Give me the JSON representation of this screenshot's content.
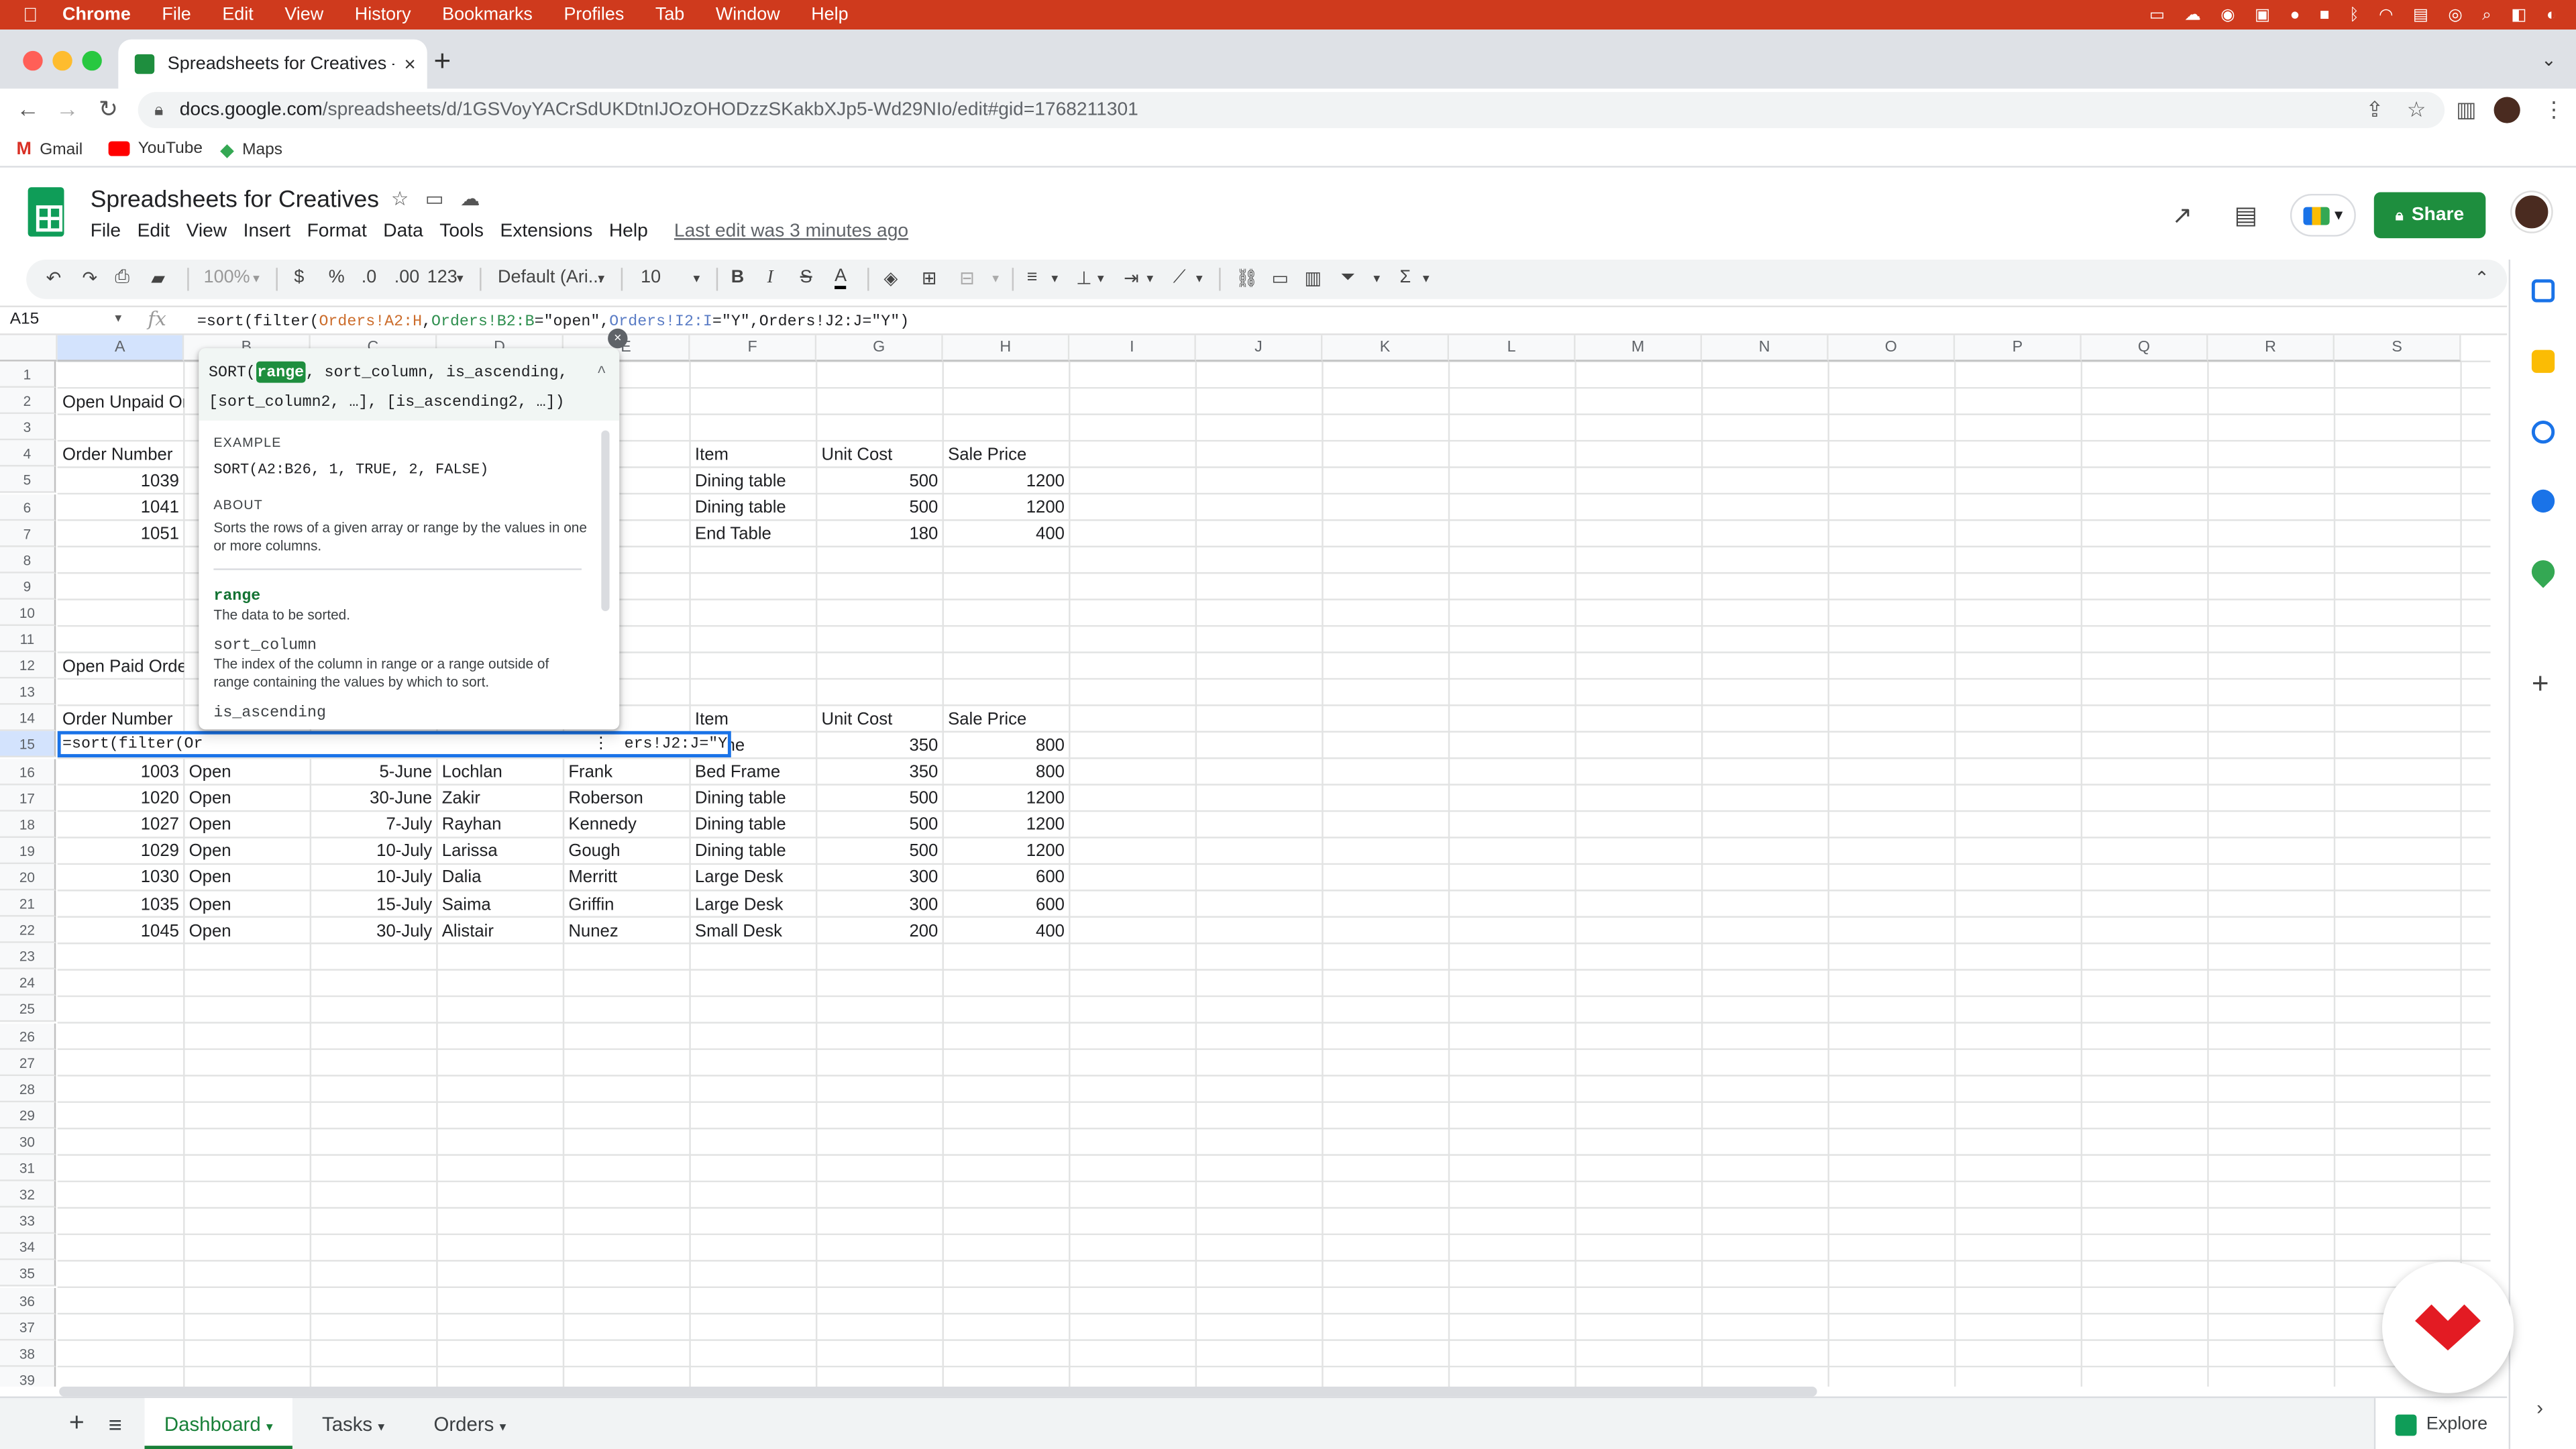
{
  "mac_menu": {
    "apple": "",
    "app": "Chrome",
    "items": [
      "File",
      "Edit",
      "View",
      "History",
      "Bookmarks",
      "Profiles",
      "Tab",
      "Window",
      "Help"
    ]
  },
  "browser": {
    "tab_title": "Spreadsheets for Creatives - G",
    "url_host": "docs.google.com",
    "url_path": "/spreadsheets/d/1GSVoyYACrSdUKDtnIJOzOHODzzSKakbXJp5-Wd29NIo/edit#gid=1768211301",
    "bookmarks": [
      "Gmail",
      "YouTube",
      "Maps"
    ]
  },
  "sheet": {
    "title": "Spreadsheets for Creatives",
    "menu": [
      "File",
      "Edit",
      "View",
      "Insert",
      "Format",
      "Data",
      "Tools",
      "Extensions",
      "Help"
    ],
    "last_edit": "Last edit was 3 minutes ago",
    "share_label": "Share"
  },
  "toolbar": {
    "zoom": "100%",
    "currency": "$",
    "percent": "%",
    "dec_dec": ".0",
    "dec_inc": ".00",
    "format_more": "123",
    "font": "Default (Ari...",
    "font_size": "10",
    "bold": "B",
    "italic": "I",
    "strike": "S",
    "text_color": "A"
  },
  "formula_bar": {
    "name_box": "A15",
    "fx": "fx",
    "parts": [
      {
        "t": "=sort(",
        "c": "fsep"
      },
      {
        "t": "filter(",
        "c": "fsep"
      },
      {
        "t": "Orders!A2:H",
        "c": "fcor"
      },
      {
        "t": ",",
        "c": "fsep"
      },
      {
        "t": "Orders!B2:B",
        "c": "fgr"
      },
      {
        "t": "=\"open\",",
        "c": "fsep"
      },
      {
        "t": "Orders!I2:I",
        "c": "fbl"
      },
      {
        "t": "=\"Y\",",
        "c": "fsep"
      },
      {
        "t": "Orders!J2:J",
        "c": "fsep"
      },
      {
        "t": "=\"Y\")",
        "c": "fsep"
      }
    ]
  },
  "columns": [
    "A",
    "B",
    "C",
    "D",
    "E",
    "F",
    "G",
    "H",
    "I",
    "J",
    "K",
    "L",
    "M",
    "N",
    "O",
    "P",
    "Q",
    "R",
    "S"
  ],
  "rows": [
    {
      "r": "1",
      "cells": {}
    },
    {
      "r": "2",
      "cells": {
        "A": "Open Unpaid Ord"
      }
    },
    {
      "r": "3",
      "cells": {}
    },
    {
      "r": "4",
      "cells": {
        "A": "Order Number",
        "E": "ame",
        "F": "Item",
        "G": "Unit Cost",
        "H": "Sale Price"
      }
    },
    {
      "r": "5",
      "cells": {
        "A": "1039",
        "F": "Dining table",
        "G": "500",
        "H": "1200"
      }
    },
    {
      "r": "6",
      "cells": {
        "A": "1041",
        "E": "vard",
        "F": "Dining table",
        "G": "500",
        "H": "1200"
      }
    },
    {
      "r": "7",
      "cells": {
        "A": "1051",
        "E": "s",
        "F": "End Table",
        "G": "180",
        "H": "400"
      }
    },
    {
      "r": "8",
      "cells": {}
    },
    {
      "r": "9",
      "cells": {}
    },
    {
      "r": "10",
      "cells": {}
    },
    {
      "r": "11",
      "cells": {}
    },
    {
      "r": "12",
      "cells": {
        "A": "Open Paid Orders"
      }
    },
    {
      "r": "13",
      "cells": {}
    },
    {
      "r": "14",
      "cells": {
        "A": "Order Number",
        "E": "ame",
        "F": "Item",
        "G": "Unit Cost",
        "H": "Sale Price"
      }
    },
    {
      "r": "15",
      "cells": {
        "F": "Frame",
        "G": "350",
        "H": "800"
      }
    },
    {
      "r": "16",
      "cells": {
        "A": "1003",
        "B": "Open",
        "C": "5-June",
        "D": "Lochlan",
        "E": "Frank",
        "F": "Bed Frame",
        "G": "350",
        "H": "800"
      }
    },
    {
      "r": "17",
      "cells": {
        "A": "1020",
        "B": "Open",
        "C": "30-June",
        "D": "Zakir",
        "E": "Roberson",
        "F": "Dining table",
        "G": "500",
        "H": "1200"
      }
    },
    {
      "r": "18",
      "cells": {
        "A": "1027",
        "B": "Open",
        "C": "7-July",
        "D": "Rayhan",
        "E": "Kennedy",
        "F": "Dining table",
        "G": "500",
        "H": "1200"
      }
    },
    {
      "r": "19",
      "cells": {
        "A": "1029",
        "B": "Open",
        "C": "10-July",
        "D": "Larissa",
        "E": "Gough",
        "F": "Dining table",
        "G": "500",
        "H": "1200"
      }
    },
    {
      "r": "20",
      "cells": {
        "A": "1030",
        "B": "Open",
        "C": "10-July",
        "D": "Dalia",
        "E": "Merritt",
        "F": "Large Desk",
        "G": "300",
        "H": "600"
      }
    },
    {
      "r": "21",
      "cells": {
        "A": "1035",
        "B": "Open",
        "C": "15-July",
        "D": "Saima",
        "E": "Griffin",
        "F": "Large Desk",
        "G": "300",
        "H": "600"
      }
    },
    {
      "r": "22",
      "cells": {
        "A": "1045",
        "B": "Open",
        "C": "30-July",
        "D": "Alistair",
        "E": "Nunez",
        "F": "Small Desk",
        "G": "200",
        "H": "400"
      }
    },
    {
      "r": "23",
      "cells": {}
    },
    {
      "r": "24",
      "cells": {}
    },
    {
      "r": "25",
      "cells": {}
    },
    {
      "r": "26",
      "cells": {}
    },
    {
      "r": "27",
      "cells": {}
    },
    {
      "r": "28",
      "cells": {}
    },
    {
      "r": "29",
      "cells": {}
    },
    {
      "r": "30",
      "cells": {}
    },
    {
      "r": "31",
      "cells": {}
    },
    {
      "r": "32",
      "cells": {}
    },
    {
      "r": "33",
      "cells": {}
    },
    {
      "r": "34",
      "cells": {}
    },
    {
      "r": "35",
      "cells": {}
    },
    {
      "r": "36",
      "cells": {}
    },
    {
      "r": "37",
      "cells": {}
    },
    {
      "r": "38",
      "cells": {}
    },
    {
      "r": "39",
      "cells": {}
    }
  ],
  "active_cell": {
    "left_text": "=sort(filter(Or",
    "right_text": "ers!J2:J=\"Y\")"
  },
  "popup": {
    "sig_fn": "SORT(",
    "sig_hl": "range",
    "sig_rest1": ", sort_column, is_ascending,",
    "sig_rest2": "[sort_column2, …], [is_ascending2, …])",
    "example_label": "EXAMPLE",
    "example": "SORT(A2:B26, 1, TRUE, 2, FALSE)",
    "about_label": "ABOUT",
    "about": "Sorts the rows of a given array or range by the values in one or more columns.",
    "p1_name": "range",
    "p1_desc": "The data to be sorted.",
    "p2_name": "sort_column",
    "p2_desc": "The index of the column in range or a range outside of range containing the values by which to sort.",
    "p3_name": "is_ascending",
    "collapse": "^",
    "close": "×"
  },
  "sheet_tabs": [
    "Dashboard",
    "Tasks",
    "Orders"
  ],
  "explore_label": "Explore",
  "colors": {
    "accent": "#1e8e3e",
    "mac_bar": "#cf3a1d",
    "selection": "#1a73e8"
  }
}
